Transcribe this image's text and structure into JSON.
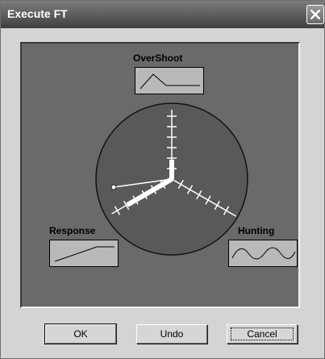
{
  "window": {
    "title": "Execute FT"
  },
  "icons": {
    "close": "close-icon"
  },
  "panel": {
    "overshoot_label": "OverShoot",
    "response_label": "Response",
    "hunting_label": "Hunting"
  },
  "buttons": {
    "ok": "OK",
    "undo": "Undo",
    "cancel": "Cancel"
  },
  "colors": {
    "panel_bg": "#6a6a6a",
    "dial_bg": "#595959",
    "thumb_bg": "#b9b9b9"
  }
}
